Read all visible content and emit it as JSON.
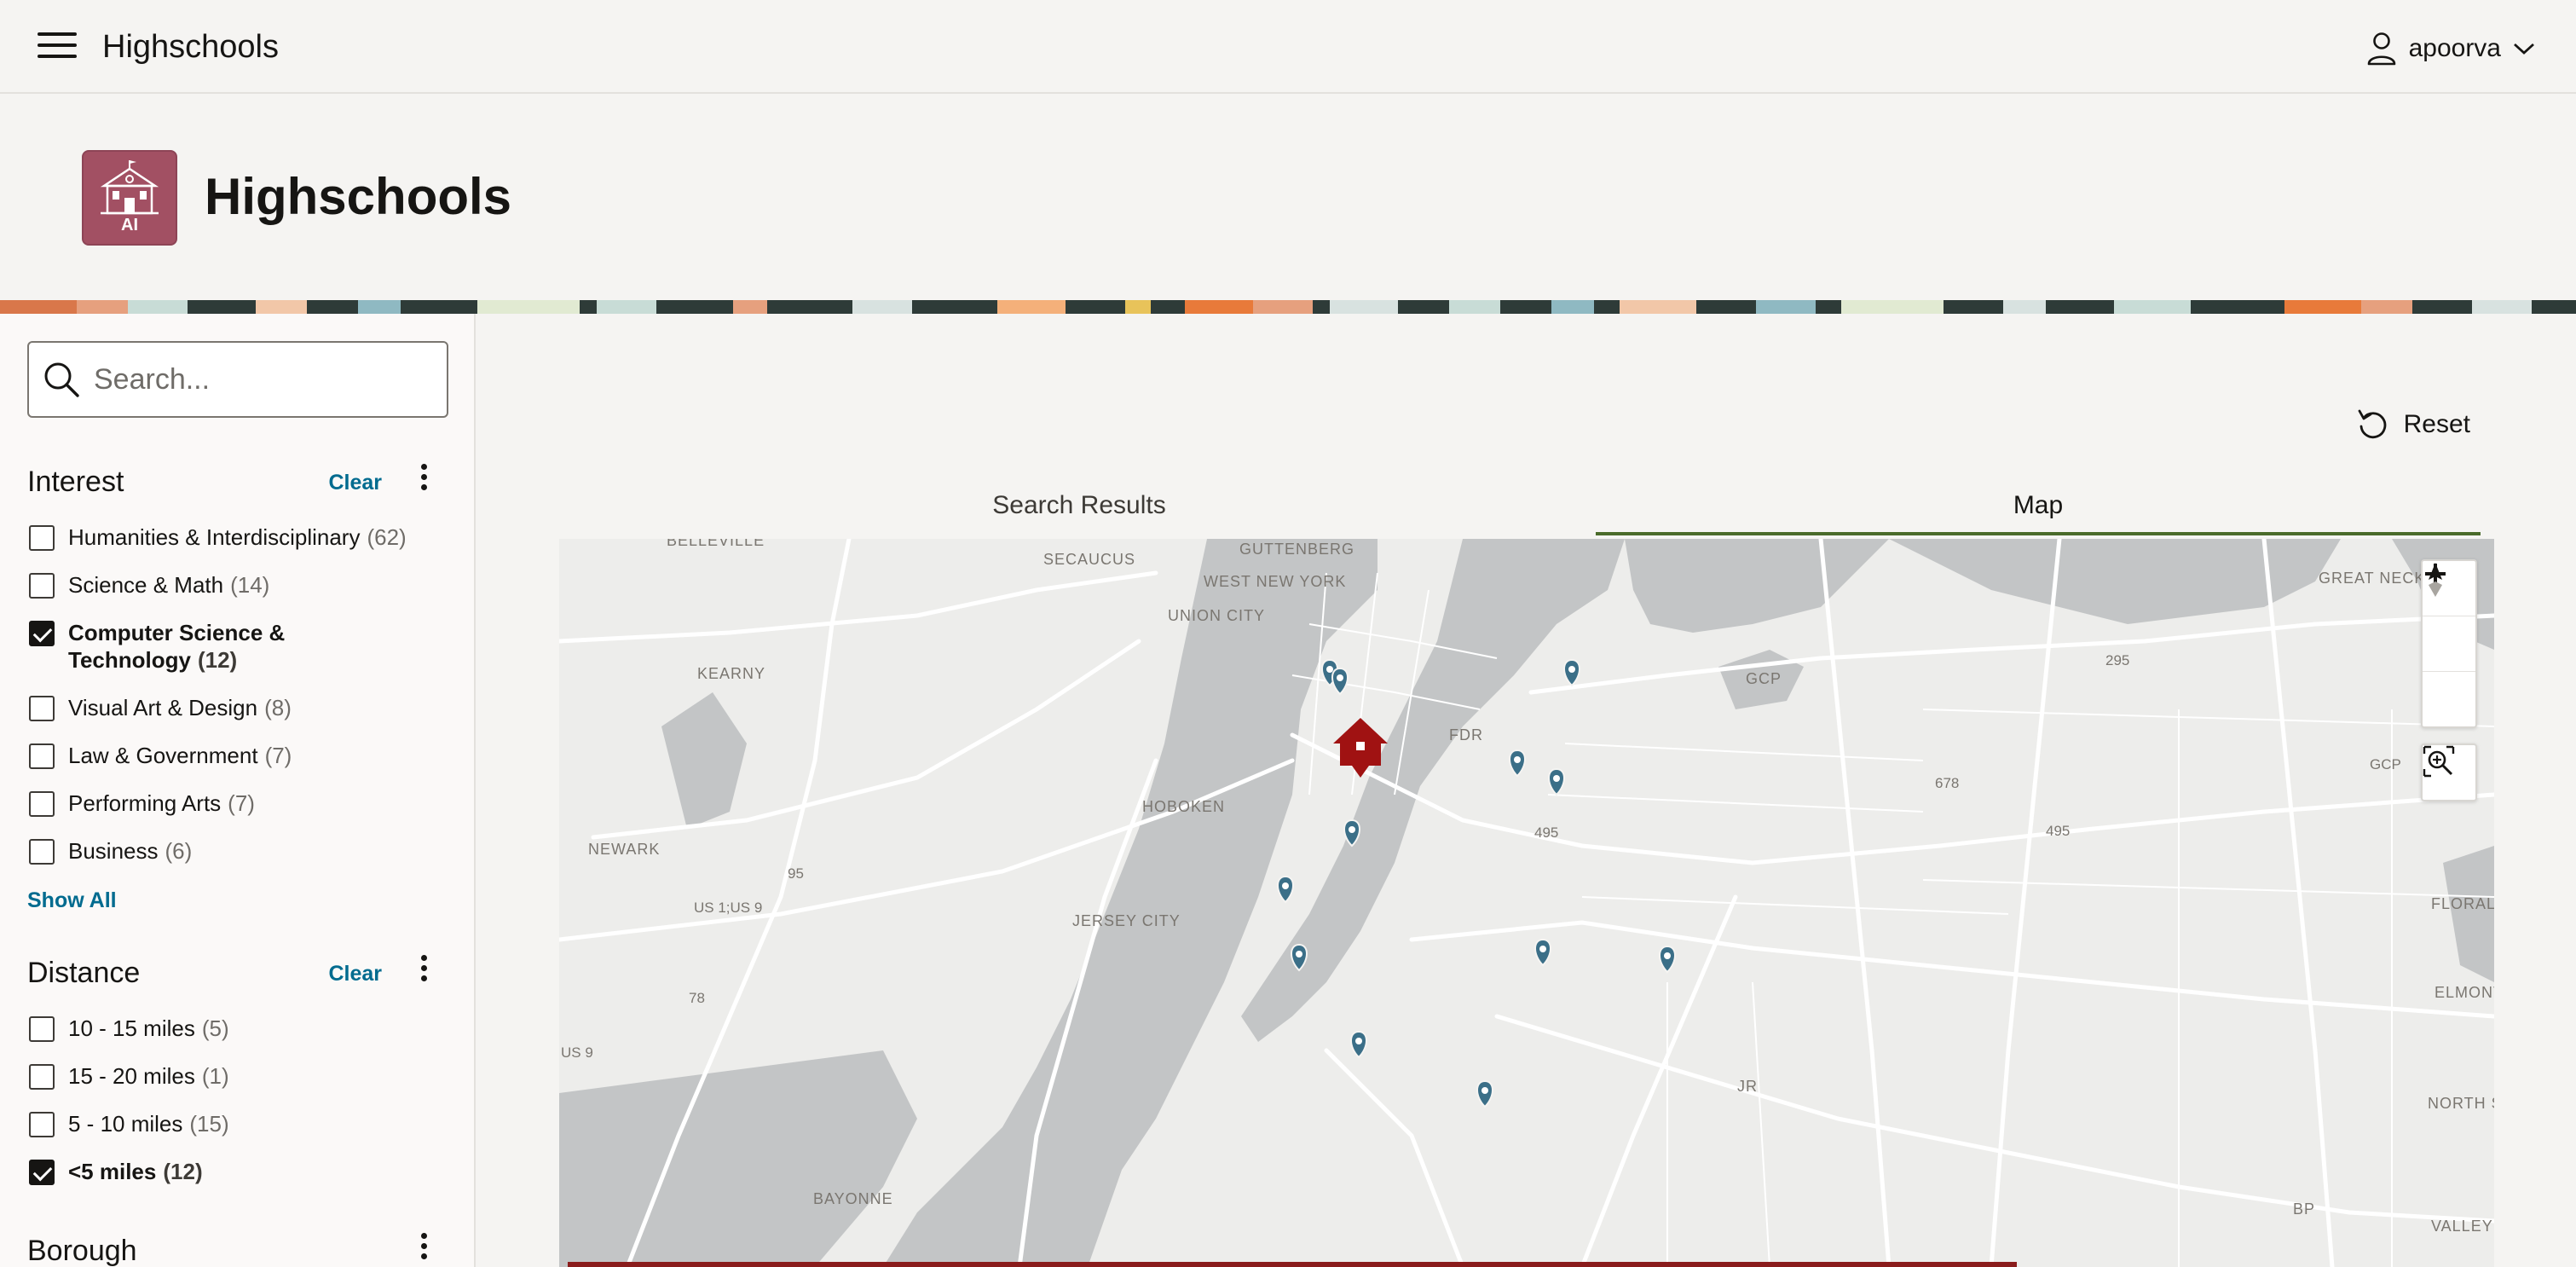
{
  "header": {
    "menu_icon": "hamburger-icon",
    "app_title": "Highschools",
    "user_icon": "user-icon",
    "username": "apoorva",
    "user_menu_icon": "chevron-down-icon"
  },
  "page": {
    "icon_name": "school-building-icon",
    "icon_label": "AI",
    "icon_color": "#a25063",
    "title": "Highschools"
  },
  "search": {
    "placeholder": "Search...",
    "value": ""
  },
  "filters": {
    "interest": {
      "title": "Interest",
      "clear_label": "Clear",
      "items": [
        {
          "label": "Humanities & Interdisciplinary",
          "count": "(62)",
          "checked": false
        },
        {
          "label": "Science & Math",
          "count": "(14)",
          "checked": false
        },
        {
          "label": "Computer Science &",
          "label_line2": "Technology",
          "count": "(12)",
          "checked": true
        },
        {
          "label": "Visual Art & Design",
          "count": "(8)",
          "checked": false
        },
        {
          "label": "Law & Government",
          "count": "(7)",
          "checked": false
        },
        {
          "label": "Performing Arts",
          "count": "(7)",
          "checked": false
        },
        {
          "label": "Business",
          "count": "(6)",
          "checked": false
        }
      ],
      "show_all_label": "Show All"
    },
    "distance": {
      "title": "Distance",
      "clear_label": "Clear",
      "items": [
        {
          "label": "10 - 15 miles",
          "count": "(5)",
          "checked": false
        },
        {
          "label": "15 - 20 miles",
          "count": "(1)",
          "checked": false
        },
        {
          "label": "5 - 10 miles",
          "count": "(15)",
          "checked": false
        },
        {
          "label": "<5 miles",
          "count": "(12)",
          "checked": true
        }
      ]
    },
    "borough": {
      "title": "Borough"
    }
  },
  "main": {
    "reset_label": "Reset",
    "tabs": [
      {
        "label": "Search Results",
        "active": false
      },
      {
        "label": "Map",
        "active": true
      }
    ]
  },
  "map": {
    "place_labels": [
      "BELLEVILLE",
      "SECAUCUS",
      "GUTTENBERG",
      "WEST NEW YORK",
      "UNION CITY",
      "KEARNY",
      "HOBOKEN",
      "NEWARK",
      "JERSEY CITY",
      "BAYONNE",
      "FDR",
      "GCP",
      "GREAT NECK",
      "FLORAL",
      "ELMONT",
      "NORTH STREAM",
      "VALLEY S",
      "JR",
      "BP"
    ],
    "road_labels": [
      "95",
      "US 1;US 9",
      "78",
      "US 9",
      "495",
      "678",
      "495",
      "295",
      "GCP"
    ],
    "home_marker_icon": "home-marker-icon",
    "school_marker_icon": "map-pin-icon",
    "school_marker_count": 13,
    "colors": {
      "home_marker": "#a01212",
      "school_marker": "#3b6f88",
      "water": "#c3c5c6",
      "land": "#ededeb"
    },
    "controls": [
      "zoom-in-icon",
      "zoom-out-icon",
      "compass-north-icon",
      "zoom-to-area-icon"
    ]
  }
}
